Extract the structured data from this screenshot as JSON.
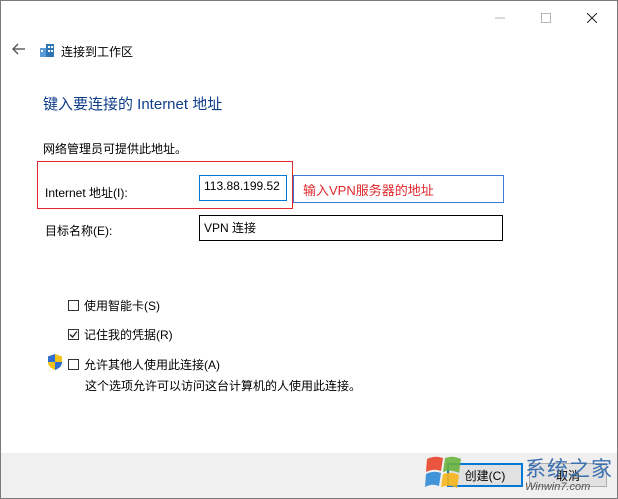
{
  "window": {
    "title": "连接到工作区",
    "controls": {
      "minimize": "minimize-icon",
      "maximize": "maximize-icon",
      "close": "close-icon"
    }
  },
  "page": {
    "heading": "键入要连接的 Internet 地址",
    "description": "网络管理员可提供此地址。"
  },
  "form": {
    "address_label": "Internet 地址(I):",
    "address_value": "113.88.199.52",
    "address_annotation": "输入VPN服务器的地址",
    "name_label": "目标名称(E):",
    "name_value": "VPN 连接"
  },
  "options": [
    {
      "label": "使用智能卡(S)",
      "checked": false
    },
    {
      "label": "记住我的凭据(R)",
      "checked": true
    },
    {
      "label": "允许其他人使用此连接(A)",
      "checked": false
    }
  ],
  "note": "这个选项允许可以访问这台计算机的人使用此连接。",
  "buttons": {
    "create": "创建(C)",
    "cancel": "取消"
  },
  "watermark": {
    "brand": "系统之家",
    "url": "Winwin7.com"
  },
  "colors": {
    "heading": "#0f3d8a",
    "annotation": "#e0292d",
    "focus": "#0078d7"
  }
}
